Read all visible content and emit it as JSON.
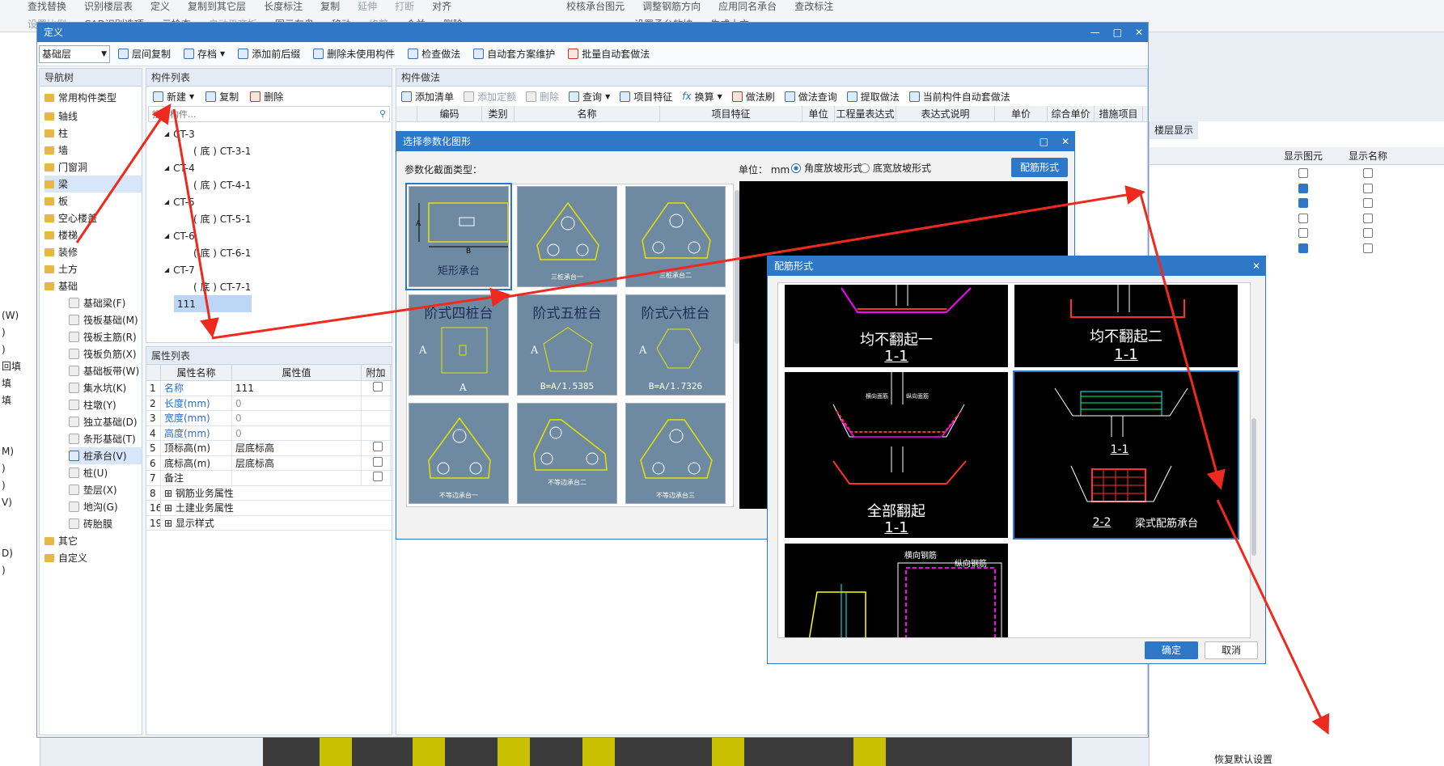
{
  "ribbon": {
    "row1": [
      "查找替换",
      "识别楼层表",
      "定义",
      "复制到其它层",
      "长度标注",
      "复制",
      "延伸",
      "打断",
      "对齐",
      "校核承台图元",
      "调整钢筋方向",
      "应用同名承台",
      "查改标注"
    ],
    "row2": [
      "设置比例",
      "CAD识别选项",
      "云检查",
      "自动平齐板",
      "图元存盘",
      "移动",
      "修剪",
      "合并",
      "删除",
      "设置承台放坡",
      "生成土方"
    ]
  },
  "def_window": {
    "title": "定义",
    "floor_select": "基础层",
    "toolbar": [
      "层间复制",
      "存档",
      "添加前后缀",
      "删除未使用构件",
      "检查做法",
      "自动套方案维护",
      "批量自动套做法"
    ]
  },
  "nav_tree": {
    "title": "导航树",
    "items": [
      "常用构件类型",
      "轴线",
      "柱",
      "墙",
      "门窗洞",
      "梁",
      "板",
      "空心楼盖",
      "楼梯",
      "装修",
      "土方",
      "基础"
    ],
    "sub_items": [
      "基础梁(F)",
      "筏板基础(M)",
      "筏板主筋(R)",
      "筏板负筋(X)",
      "基础板带(W)",
      "集水坑(K)",
      "柱墩(Y)",
      "独立基础(D)",
      "条形基础(T)",
      "桩承台(V)",
      "桩(U)",
      "垫层(X)",
      "地沟(G)",
      "砖胎膜"
    ],
    "tail_items": [
      "其它",
      "自定义"
    ]
  },
  "comp_list": {
    "title": "构件列表",
    "new": "新建",
    "copy": "复制",
    "delete": "删除",
    "search_placeholder": "搜索构件...",
    "tree": [
      "CT-3",
      "( 底 ) CT-3-1",
      "CT-4",
      "( 底 ) CT-4-1",
      "CT-5",
      "( 底 ) CT-5-1",
      "CT-6",
      "( 底 ) CT-6-1",
      "CT-7",
      "( 底 ) CT-7-1",
      "111"
    ]
  },
  "props": {
    "title": "属性列表",
    "headers": [
      "属性名称",
      "属性值",
      "附加"
    ],
    "rows": [
      {
        "no": "1",
        "name": "名称",
        "value": "111"
      },
      {
        "no": "2",
        "name": "长度(mm)",
        "value": "0"
      },
      {
        "no": "3",
        "name": "宽度(mm)",
        "value": "0"
      },
      {
        "no": "4",
        "name": "高度(mm)",
        "value": "0"
      },
      {
        "no": "5",
        "name": "顶标高(m)",
        "value": "层底标高"
      },
      {
        "no": "6",
        "name": "底标高(m)",
        "value": "层底标高"
      },
      {
        "no": "7",
        "name": "备注",
        "value": ""
      },
      {
        "no": "8",
        "name": "钢筋业务属性",
        "value": ""
      },
      {
        "no": "16",
        "name": "土建业务属性",
        "value": ""
      },
      {
        "no": "19",
        "name": "显示样式",
        "value": ""
      }
    ]
  },
  "method": {
    "title": "构件做法",
    "toolbar": [
      "添加清单",
      "添加定额",
      "删除",
      "查询",
      "项目特征",
      "换算",
      "做法刷",
      "做法查询",
      "提取做法",
      "当前构件自动套做法"
    ],
    "headers": [
      "编码",
      "类别",
      "名称",
      "项目特征",
      "单位",
      "工程量表达式",
      "表达式说明",
      "单价",
      "综合单价",
      "措施项目"
    ]
  },
  "right_panel": {
    "tab": "楼层显示",
    "headers": [
      "显示图元",
      "显示名称"
    ],
    "restore": "恢复默认设置"
  },
  "left_strip": [
    "(W)",
    ")",
    ")",
    "回填",
    "填",
    "填",
    "M)",
    ")",
    ")",
    "V)",
    "D)",
    ")"
  ],
  "param_dialog": {
    "title": "选择参数化图形",
    "section_label": "参数化截面类型：",
    "unit_label": "单位：  mm",
    "radio1": "角度放坡形式",
    "radio2": "底宽放坡形式",
    "rebar_button": "配筋形式",
    "thumbs": [
      "矩形承台",
      "三桩承台一",
      "三桩承台二",
      "阶式四桩台",
      "阶式五桩台",
      "阶式六桩台",
      "不等边承台一",
      "不等边承台二",
      "不等边承台三"
    ],
    "formulas": [
      "B=A/1.5385",
      "B=A/1.7326"
    ]
  },
  "rebar_dialog": {
    "title": "配筋形式",
    "items": [
      {
        "name": "均不翻起一",
        "sec": "1-1"
      },
      {
        "name": "均不翻起二",
        "sec": "1-1"
      },
      {
        "name": "全部翻起",
        "sec": "1-1"
      },
      {
        "name": "梁式配筋承台",
        "sec": "1-1",
        "sec2": "2-2"
      }
    ],
    "detail_labels": [
      "横向钢筋",
      "纵向钢筋"
    ],
    "ok": "确定",
    "cancel": "取消"
  },
  "colors": {
    "accent": "#2f78c8",
    "arrow": "#ee2a1e"
  }
}
